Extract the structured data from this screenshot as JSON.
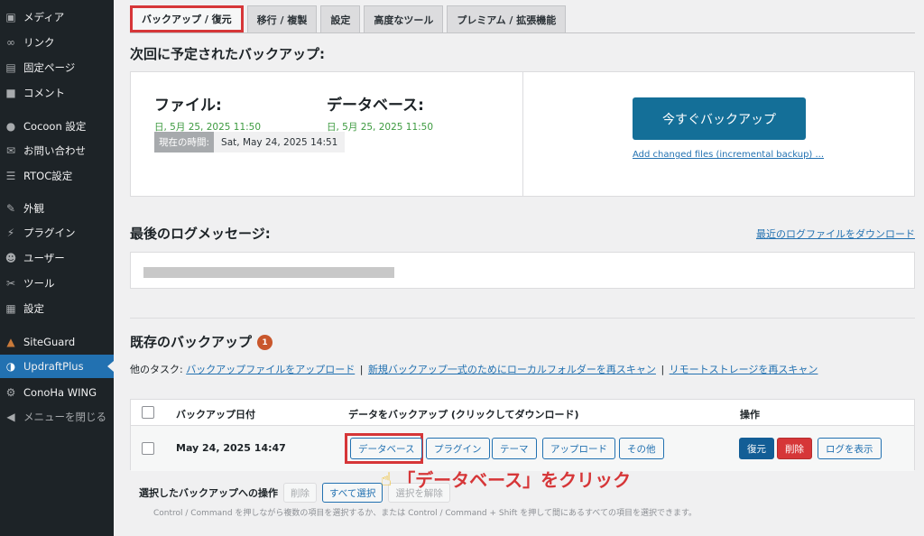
{
  "sidebar": {
    "items": [
      {
        "label": "メディア",
        "icon": "media-icon"
      },
      {
        "label": "リンク",
        "icon": "link-icon"
      },
      {
        "label": "固定ページ",
        "icon": "page-icon"
      },
      {
        "label": "コメント",
        "icon": "comment-icon"
      },
      {
        "label": "Cocoon 設定",
        "icon": "cocoon-icon"
      },
      {
        "label": "お問い合わせ",
        "icon": "mail-icon"
      },
      {
        "label": "RTOC設定",
        "icon": "list-icon"
      },
      {
        "label": "外観",
        "icon": "appearance-icon"
      },
      {
        "label": "プラグイン",
        "icon": "plugin-icon"
      },
      {
        "label": "ユーザー",
        "icon": "user-icon"
      },
      {
        "label": "ツール",
        "icon": "tools-icon"
      },
      {
        "label": "設定",
        "icon": "settings-icon"
      },
      {
        "label": "SiteGuard",
        "icon": "siteguard-icon"
      },
      {
        "label": "UpdraftPlus",
        "icon": "updraftplus-icon",
        "active": true
      },
      {
        "label": "ConoHa WING",
        "icon": "gear-icon"
      },
      {
        "label": "メニューを閉じる",
        "icon": "collapse-icon"
      }
    ]
  },
  "tabs": [
    "バックアップ / 復元",
    "移行 / 複製",
    "設定",
    "高度なツール",
    "プレミアム / 拡張機能"
  ],
  "next_backup": {
    "heading": "次回に予定されたバックアップ:",
    "files_title": "ファイル:",
    "files_date": "日, 5月 25, 2025 11:50",
    "db_title": "データベース:",
    "db_date": "日, 5月 25, 2025 11:50",
    "current_time_label": "現在の時間:",
    "current_time_value": "Sat, May 24, 2025 14:51",
    "backup_now_label": "今すぐバックアップ",
    "incremental_link": "Add changed files (incremental backup) ..."
  },
  "log": {
    "heading": "最後のログメッセージ:",
    "download_link": "最近のログファイルをダウンロード"
  },
  "existing": {
    "heading": "既存のバックアップ",
    "count": "1",
    "other_tasks_label": "他のタスク:",
    "other_tasks": [
      "バックアップファイルをアップロード",
      "新規バックアップ一式のためにローカルフォルダーを再スキャン",
      "リモートストレージを再スキャン"
    ],
    "columns": {
      "date": "バックアップ日付",
      "data": "データをバックアップ (クリックしてダウンロード)",
      "actions": "操作"
    },
    "rows": [
      {
        "date": "May 24, 2025 14:47",
        "data_buttons": [
          "データベース",
          "プラグイン",
          "テーマ",
          "アップロード",
          "その他"
        ],
        "actions": {
          "restore": "復元",
          "delete": "削除",
          "view_log": "ログを表示"
        }
      }
    ],
    "selected_ops_label": "選択したバックアップへの操作",
    "selected_ops": {
      "delete": "削除",
      "select_all": "すべて選択",
      "deselect": "選択を解除"
    },
    "hint": "Control / Command を押しながら複数の項目を選択するか、または Control / Command + Shift を押して間にあるすべての項目を選択できます。"
  },
  "annotation": {
    "text": "「データベース」をクリック",
    "icon": "pointing-hand-icon"
  },
  "colors": {
    "accent": "#2271b1",
    "highlight": "#d63638",
    "success": "#3c9a3f",
    "sidebar": "#1d2327"
  }
}
